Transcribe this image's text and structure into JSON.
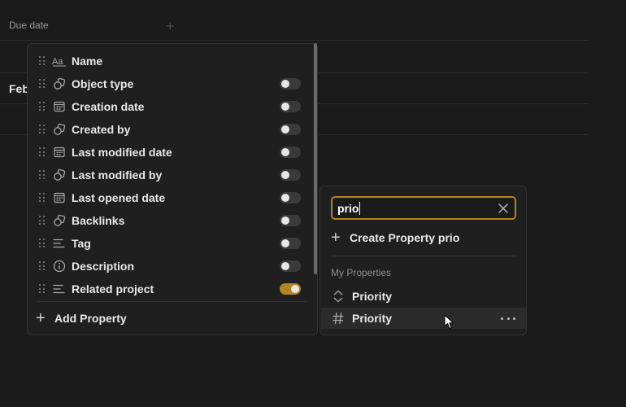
{
  "background": {
    "column_header": "Due date",
    "cell_text": "Feb"
  },
  "properties_panel": {
    "items": [
      {
        "label": "Name",
        "icon": "text-aa-icon",
        "toggle": null
      },
      {
        "label": "Object type",
        "icon": "relation-shapes-icon",
        "toggle": false
      },
      {
        "label": "Creation date",
        "icon": "calendar-icon",
        "toggle": false
      },
      {
        "label": "Created by",
        "icon": "relation-shapes-icon",
        "toggle": false
      },
      {
        "label": "Last modified date",
        "icon": "calendar-icon",
        "toggle": false
      },
      {
        "label": "Last modified by",
        "icon": "relation-shapes-icon",
        "toggle": false
      },
      {
        "label": "Last opened date",
        "icon": "calendar-icon",
        "toggle": false
      },
      {
        "label": "Backlinks",
        "icon": "relation-shapes-icon",
        "toggle": false
      },
      {
        "label": "Tag",
        "icon": "list-lines-icon",
        "toggle": false
      },
      {
        "label": "Description",
        "icon": "info-circle-icon",
        "toggle": false
      },
      {
        "label": "Related project",
        "icon": "list-lines-icon",
        "toggle": true
      }
    ],
    "add_property_label": "Add Property"
  },
  "search_panel": {
    "query": "prio",
    "create_label": "Create Property prio",
    "section_label": "My Properties",
    "results": [
      {
        "label": "Priority",
        "icon": "select-updown-icon"
      },
      {
        "label": "Priority",
        "icon": "hash-number-icon"
      }
    ]
  },
  "colors": {
    "accent": "#b38420",
    "panel_bg": "#1f1f1f",
    "page_bg": "#1a1a1a"
  }
}
